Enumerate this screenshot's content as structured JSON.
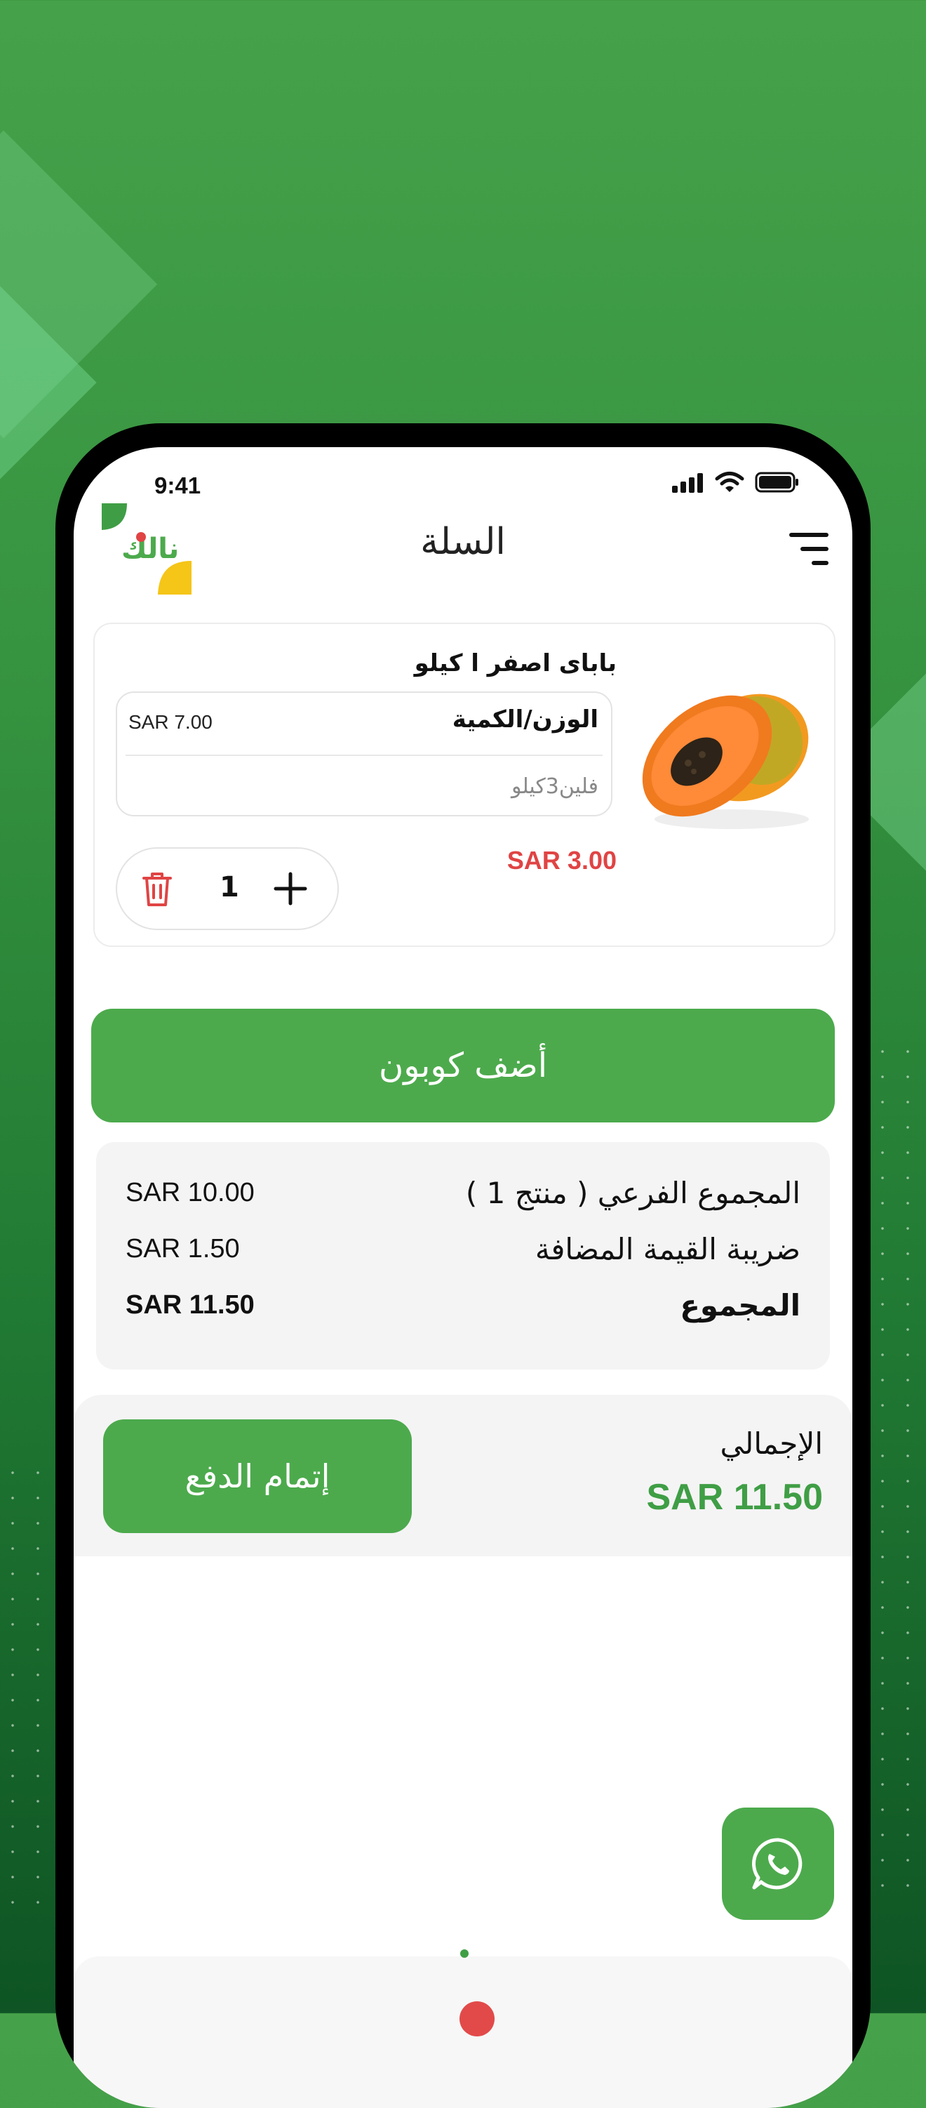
{
  "status_bar": {
    "time": "9:41"
  },
  "header": {
    "title": "السلة",
    "logo_text": "نالك"
  },
  "product": {
    "name": "بابای اصفر ا کیلو",
    "variant_label": "الوزن/الكمية",
    "variant_price": "SAR 7.00",
    "variant_value": "فلين3كيلو",
    "price": "SAR 3.00",
    "quantity": "1"
  },
  "coupon": {
    "label": "أضف كوبون"
  },
  "summary": {
    "subtotal_label": "المجموع الفرعي ( منتج 1 )",
    "subtotal_value": "SAR 10.00",
    "vat_label": "ضريبة القيمة المضافة",
    "vat_value": "SAR 1.50",
    "total_label": "المجموع",
    "total_value": "SAR 11.50"
  },
  "checkout": {
    "grand_label": "الإجمالي",
    "grand_value": "SAR 11.50",
    "button_label": "إتمام الدفع"
  },
  "colors": {
    "brand_green": "#4caa4c",
    "price_red": "#e04444",
    "total_green": "#3f9e45"
  },
  "icons": [
    "menu-icon",
    "trash-icon",
    "plus-icon",
    "whatsapp-icon",
    "signal-icon",
    "wifi-icon",
    "battery-icon"
  ]
}
